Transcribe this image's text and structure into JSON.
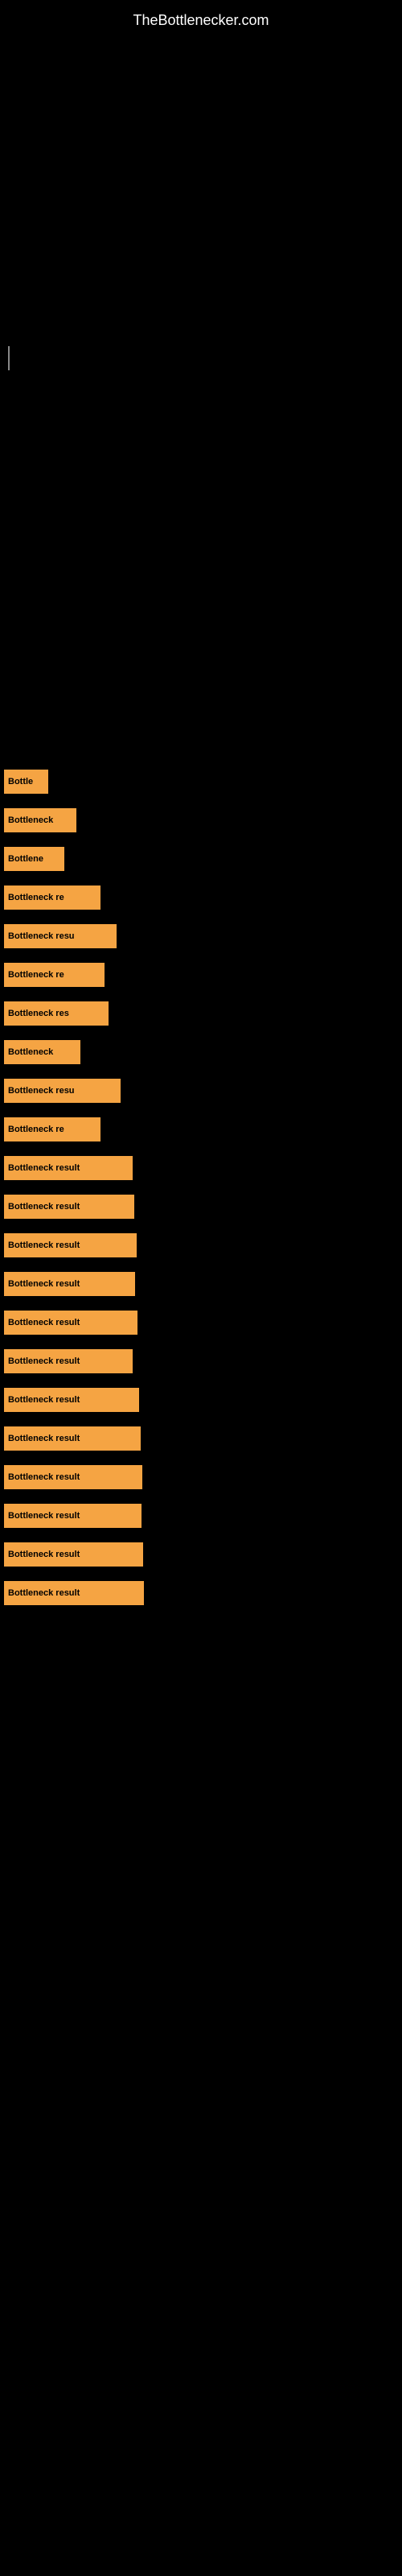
{
  "site": {
    "title": "TheBottlenecker.com"
  },
  "bars": [
    {
      "label": "Bottle",
      "width": 55,
      "id": "bar-1"
    },
    {
      "label": "Bottleneck",
      "width": 90,
      "id": "bar-2"
    },
    {
      "label": "Bottlene",
      "width": 75,
      "id": "bar-3"
    },
    {
      "label": "Bottleneck re",
      "width": 120,
      "id": "bar-4"
    },
    {
      "label": "Bottleneck resu",
      "width": 140,
      "id": "bar-5"
    },
    {
      "label": "Bottleneck re",
      "width": 125,
      "id": "bar-6"
    },
    {
      "label": "Bottleneck res",
      "width": 130,
      "id": "bar-7"
    },
    {
      "label": "Bottleneck",
      "width": 95,
      "id": "bar-8"
    },
    {
      "label": "Bottleneck resu",
      "width": 145,
      "id": "bar-9"
    },
    {
      "label": "Bottleneck re",
      "width": 120,
      "id": "bar-10"
    },
    {
      "label": "Bottleneck result",
      "width": 160,
      "id": "bar-11"
    },
    {
      "label": "Bottleneck result",
      "width": 162,
      "id": "bar-12"
    },
    {
      "label": "Bottleneck result",
      "width": 165,
      "id": "bar-13"
    },
    {
      "label": "Bottleneck result",
      "width": 163,
      "id": "bar-14"
    },
    {
      "label": "Bottleneck result",
      "width": 166,
      "id": "bar-15"
    },
    {
      "label": "Bottleneck result",
      "width": 160,
      "id": "bar-16"
    },
    {
      "label": "Bottleneck result",
      "width": 168,
      "id": "bar-17"
    },
    {
      "label": "Bottleneck result",
      "width": 170,
      "id": "bar-18"
    },
    {
      "label": "Bottleneck result",
      "width": 172,
      "id": "bar-19"
    },
    {
      "label": "Bottleneck result",
      "width": 171,
      "id": "bar-20"
    },
    {
      "label": "Bottleneck result",
      "width": 173,
      "id": "bar-21"
    },
    {
      "label": "Bottleneck result",
      "width": 174,
      "id": "bar-22"
    }
  ]
}
